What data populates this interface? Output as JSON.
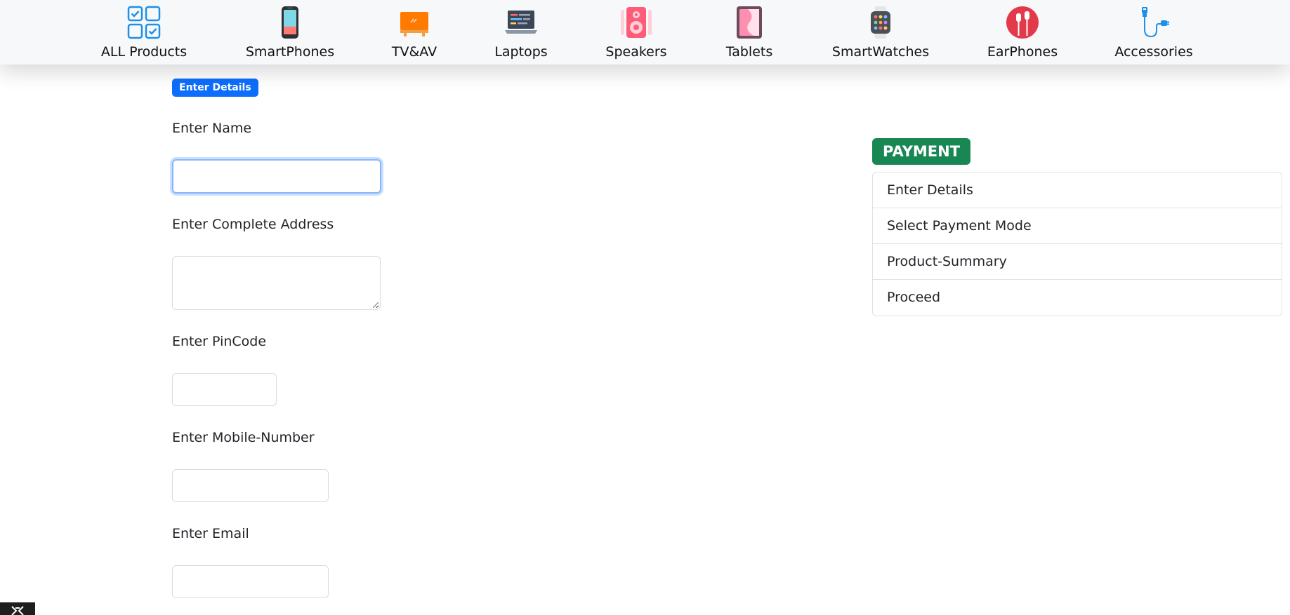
{
  "categories": [
    {
      "label": "ALL Products",
      "icon": "grid-check-icon"
    },
    {
      "label": "SmartPhones",
      "icon": "smartphone-icon"
    },
    {
      "label": "TV&AV",
      "icon": "tv-icon"
    },
    {
      "label": "Laptops",
      "icon": "laptop-icon"
    },
    {
      "label": "Speakers",
      "icon": "speaker-icon"
    },
    {
      "label": "Tablets",
      "icon": "tablet-icon"
    },
    {
      "label": "SmartWatches",
      "icon": "smartwatch-icon"
    },
    {
      "label": "EarPhones",
      "icon": "earphones-icon"
    },
    {
      "label": "Accessories",
      "icon": "usb-cable-icon"
    }
  ],
  "form": {
    "badge": "Enter Details",
    "name_label": "Enter Name",
    "name_value": "",
    "address_label": "Enter Complete Address",
    "address_value": "",
    "pincode_label": "Enter PinCode",
    "pincode_value": "",
    "mobile_label": "Enter Mobile-Number",
    "mobile_value": "",
    "email_label": "Enter Email",
    "email_value": ""
  },
  "payment": {
    "badge": "PAYMENT",
    "steps": [
      "Enter Details",
      "Select Payment Mode",
      "Product-Summary",
      "Proceed"
    ]
  },
  "colors": {
    "primary": "#0d6efd",
    "success": "#198754",
    "focus_ring": "#86b7fe"
  }
}
